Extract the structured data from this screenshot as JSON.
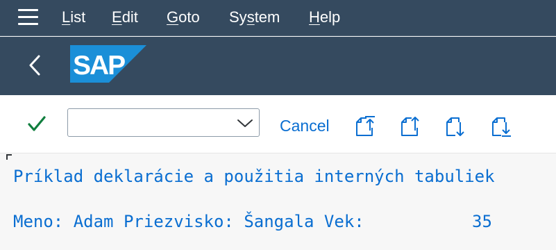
{
  "menu": {
    "items": [
      {
        "mnemonic": "L",
        "rest": "ist"
      },
      {
        "mnemonic": "E",
        "rest": "dit"
      },
      {
        "mnemonic": "G",
        "rest": "oto"
      },
      {
        "pre": "Sy",
        "mnemonic": "s",
        "rest": "tem"
      },
      {
        "mnemonic": "H",
        "rest": "elp"
      }
    ]
  },
  "header": {
    "logo_text": "SAP"
  },
  "toolbar": {
    "command_field_value": "",
    "cancel_label": "Cancel"
  },
  "report": {
    "title": "Príklad deklarácie a použitia interných tabuliek",
    "record_text": "Meno: Adam Priezvisko: Šangala Vek:",
    "age_value": "35"
  },
  "colors": {
    "shell": "#354a5f",
    "link": "#0a6ed1",
    "check": "#107e3e",
    "logo": "#1b8fd8"
  }
}
